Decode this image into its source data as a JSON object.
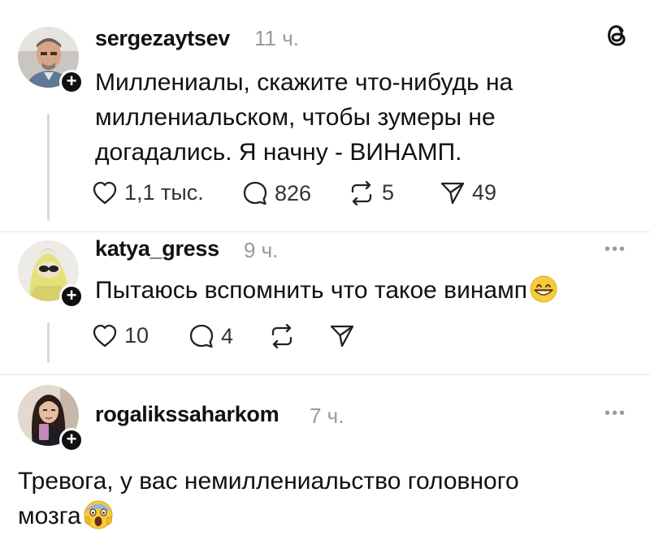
{
  "app": {
    "logo_icon": "threads-logo-icon"
  },
  "posts": [
    {
      "username": "sergezaytsev",
      "time": "11 ч.",
      "text_lines": [
        "Миллениалы, скажите что-нибудь на",
        "миллениальском, чтобы зумеры не",
        "догадались. Я начну - ВИНАМП."
      ],
      "actions": {
        "likes": "1,1 тыс.",
        "comments": "826",
        "reposts": "5",
        "shares": "49"
      }
    },
    {
      "username": "katya_gress",
      "time": "9 ч.",
      "text": "Пытаюсь вспомнить что такое винамп",
      "emoji": "grinning-face-emoji",
      "actions": {
        "likes": "10",
        "comments": "4"
      }
    },
    {
      "username": "rogalikssaharkom",
      "time": "7 ч.",
      "text_lines": [
        "Тревога, у вас немиллениальство головного",
        "мозга"
      ],
      "emoji": "screaming-face-emoji"
    }
  ],
  "more_label": "•••"
}
